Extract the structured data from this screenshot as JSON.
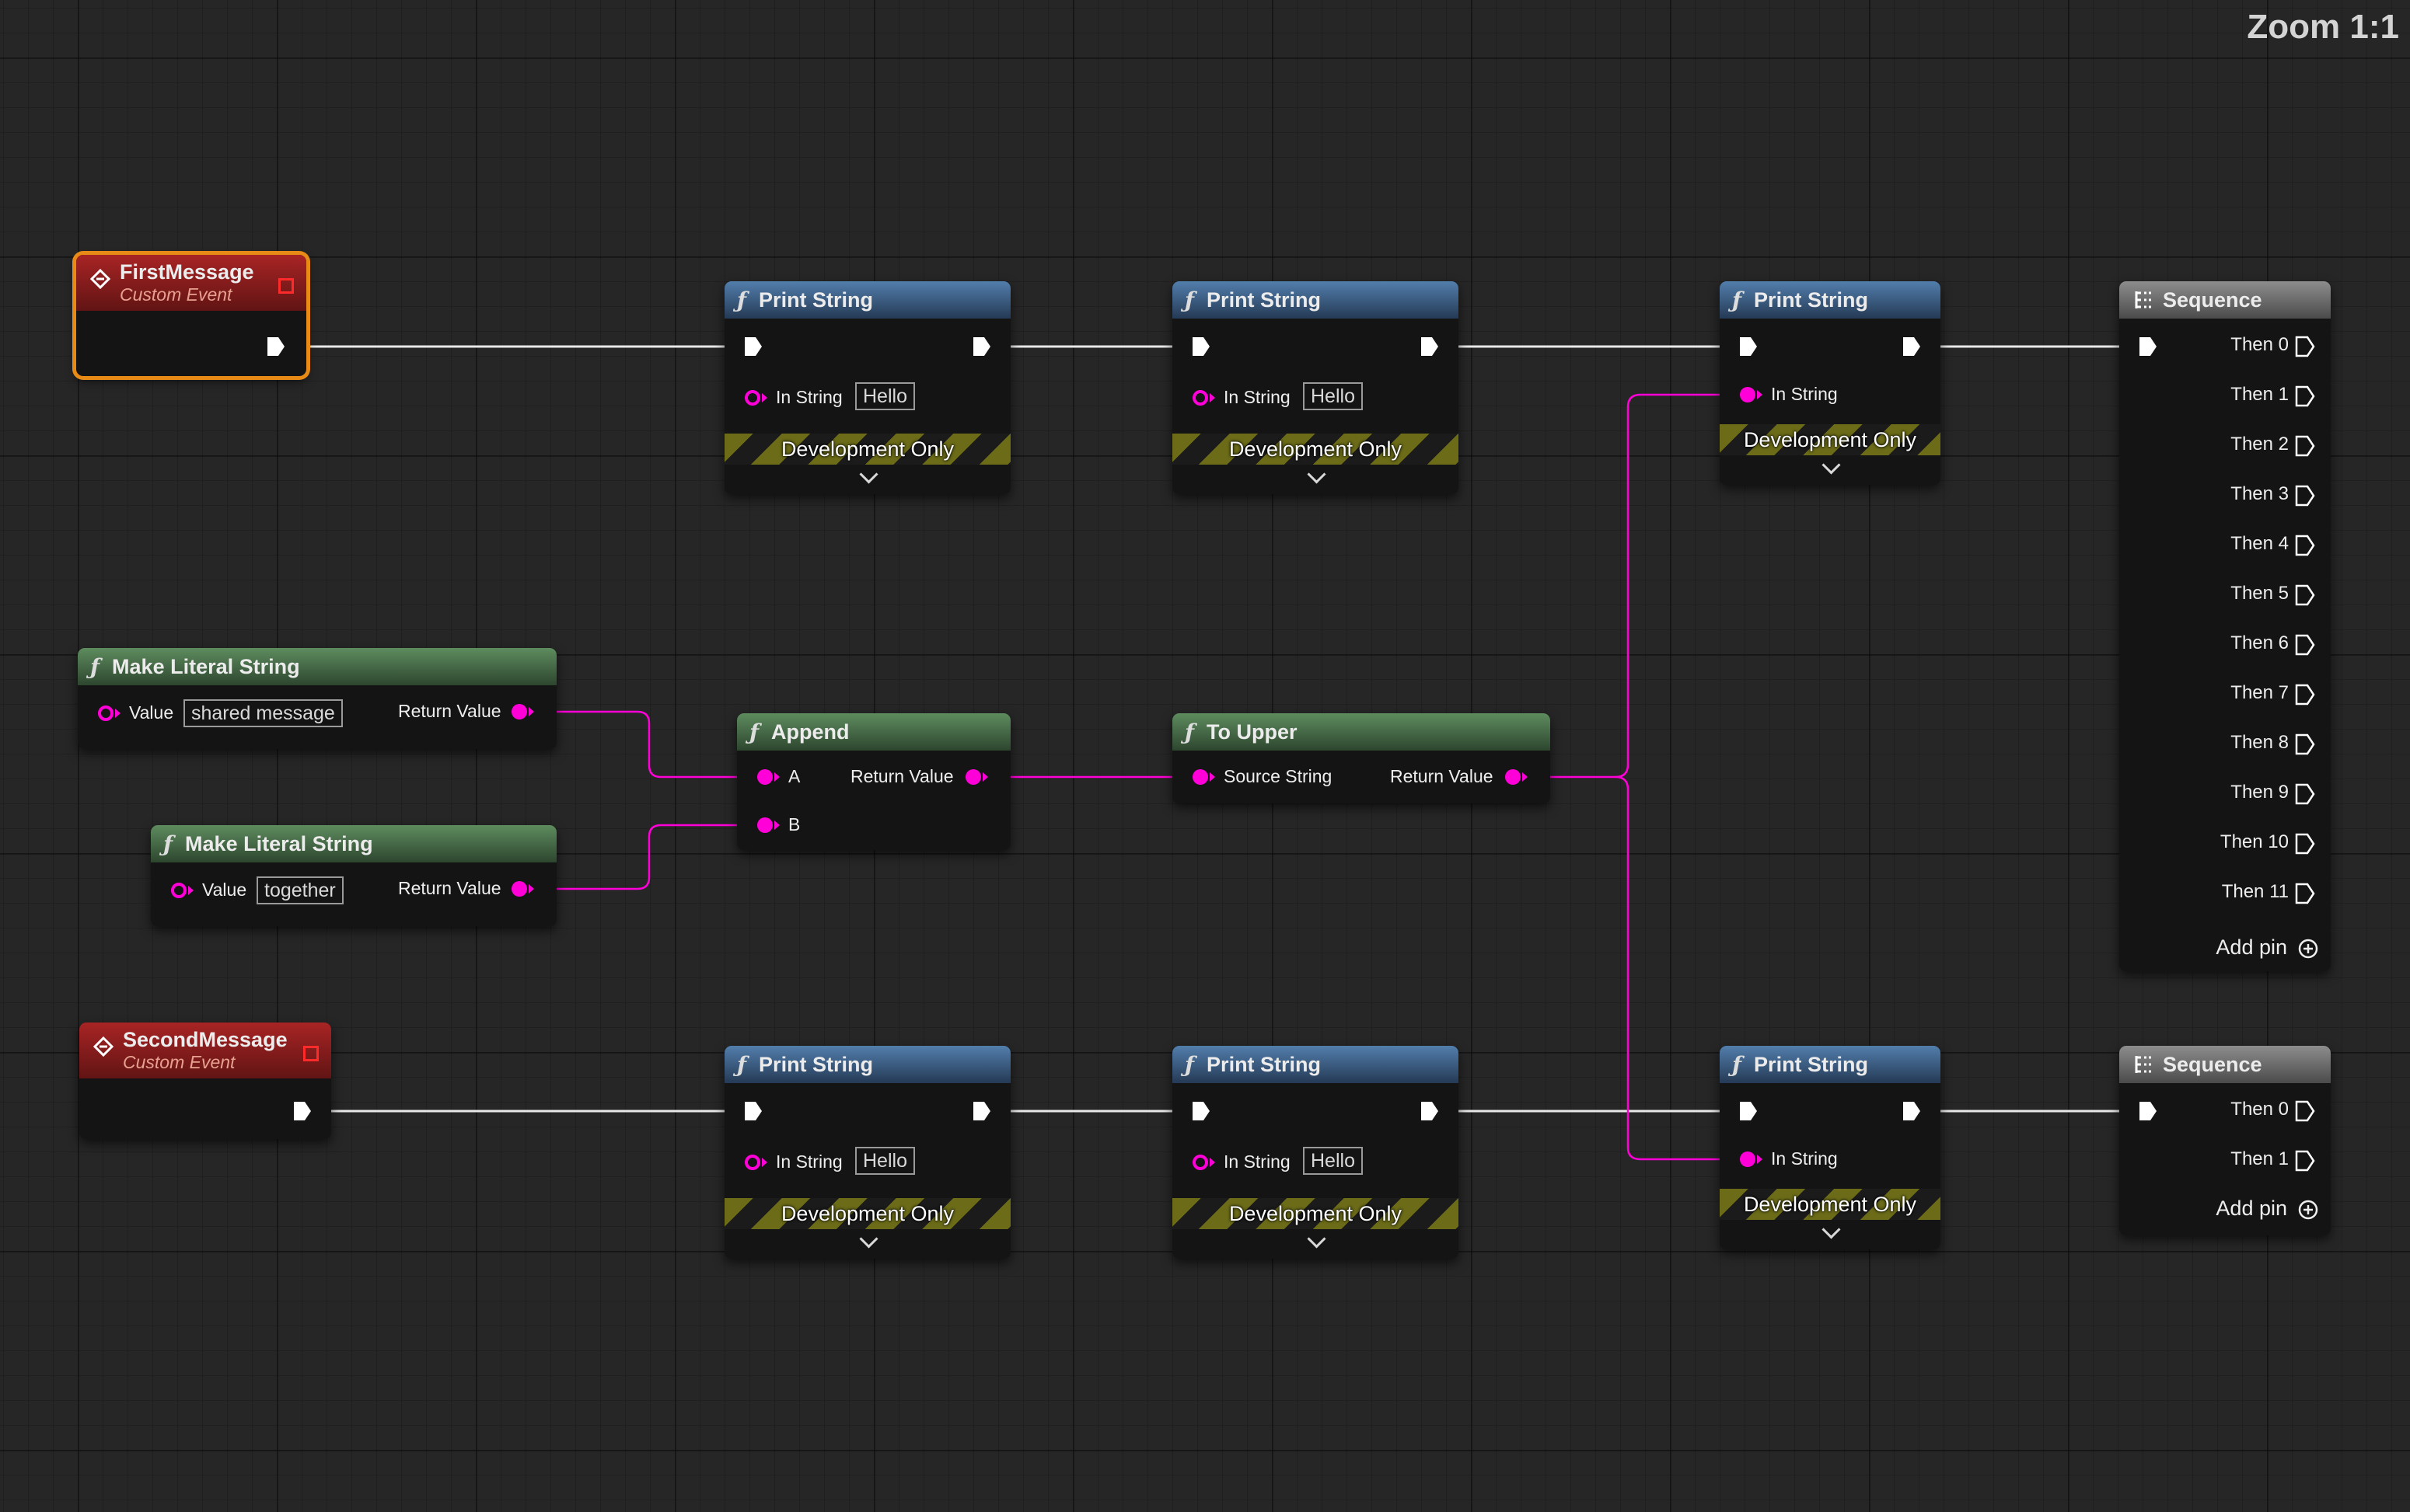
{
  "zoom_label": "Zoom 1:1",
  "events": {
    "first": {
      "title": "FirstMessage",
      "subtitle": "Custom Event"
    },
    "second": {
      "title": "SecondMessage",
      "subtitle": "Custom Event"
    }
  },
  "print_strings": [
    {
      "title": "Print String",
      "pin_label": "In String",
      "value": "Hello",
      "footer": "Development Only"
    },
    {
      "title": "Print String",
      "pin_label": "In String",
      "value": "Hello",
      "footer": "Development Only"
    },
    {
      "title": "Print String",
      "pin_label": "In String",
      "footer": "Development Only"
    },
    {
      "title": "Print String",
      "pin_label": "In String",
      "value": "Hello",
      "footer": "Development Only"
    },
    {
      "title": "Print String",
      "pin_label": "In String",
      "value": "Hello",
      "footer": "Development Only"
    },
    {
      "title": "Print String",
      "pin_label": "In String",
      "footer": "Development Only"
    }
  ],
  "literals": [
    {
      "title": "Make Literal String",
      "in_label": "Value",
      "value": "shared message",
      "out_label": "Return Value"
    },
    {
      "title": "Make Literal String",
      "in_label": "Value",
      "value": "together",
      "out_label": "Return Value"
    }
  ],
  "append": {
    "title": "Append",
    "a": "A",
    "b": "B",
    "out_label": "Return Value"
  },
  "to_upper": {
    "title": "To Upper",
    "in_label": "Source String",
    "out_label": "Return Value"
  },
  "sequences": [
    {
      "title": "Sequence",
      "outputs": [
        "Then 0",
        "Then 1",
        "Then 2",
        "Then 3",
        "Then 4",
        "Then 5",
        "Then 6",
        "Then 7",
        "Then 8",
        "Then 9",
        "Then 10",
        "Then 11"
      ],
      "add_pin": "Add pin"
    },
    {
      "title": "Sequence",
      "outputs": [
        "Then 0",
        "Then 1"
      ],
      "add_pin": "Add pin"
    }
  ],
  "colors": {
    "exec_wire": "#e8e8e8",
    "string_wire": "#ff00d8",
    "selection": "#e88b16"
  }
}
